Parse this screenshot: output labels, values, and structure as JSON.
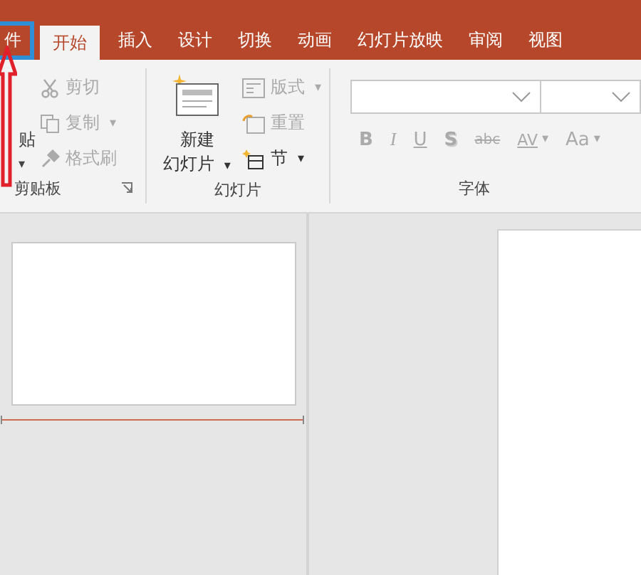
{
  "tabs": [
    {
      "label": "件",
      "selected": false,
      "focused": true
    },
    {
      "label": "开始",
      "selected": true,
      "focused": false
    },
    {
      "label": "插入",
      "selected": false,
      "focused": false
    },
    {
      "label": "设计",
      "selected": false,
      "focused": false
    },
    {
      "label": "切换",
      "selected": false,
      "focused": false
    },
    {
      "label": "动画",
      "selected": false,
      "focused": false
    },
    {
      "label": "幻灯片放映",
      "selected": false,
      "focused": false
    },
    {
      "label": "审阅",
      "selected": false,
      "focused": false
    },
    {
      "label": "视图",
      "selected": false,
      "focused": false
    }
  ],
  "clipboard": {
    "paste": {
      "label": "贴",
      "caret": "▾"
    },
    "items": [
      {
        "kind": "cut",
        "label": "剪切",
        "disabled": true
      },
      {
        "kind": "copy",
        "label": "复制",
        "disabled": true,
        "caret": "▾"
      },
      {
        "kind": "painter",
        "label": "格式刷",
        "disabled": true
      }
    ],
    "label": "剪贴板"
  },
  "slides": {
    "new_slide": {
      "line_1": "新建",
      "line_2": "幻灯片",
      "caret": "▾",
      "disabled": false
    },
    "items": [
      {
        "kind": "layout",
        "label": "版式",
        "disabled": true,
        "caret": "▾"
      },
      {
        "kind": "reset",
        "label": "重置",
        "disabled": true
      },
      {
        "kind": "section",
        "label": "节",
        "disabled": false,
        "caret": "▾"
      }
    ],
    "label": "幻灯片"
  },
  "font": {
    "format_buttons": [
      {
        "kind": "bold",
        "label": "B",
        "disabled": true
      },
      {
        "kind": "italic",
        "label": "I",
        "disabled": true
      },
      {
        "kind": "underline",
        "label": "U",
        "disabled": true
      },
      {
        "kind": "shadow",
        "label": "S",
        "disabled": true
      },
      {
        "kind": "strike",
        "label": "abc",
        "disabled": true
      },
      {
        "kind": "spacing",
        "label": "AV",
        "disabled": true,
        "caret": "▾"
      },
      {
        "kind": "case",
        "label": "Aa",
        "disabled": true,
        "caret": "▾"
      }
    ],
    "label": "字体"
  }
}
